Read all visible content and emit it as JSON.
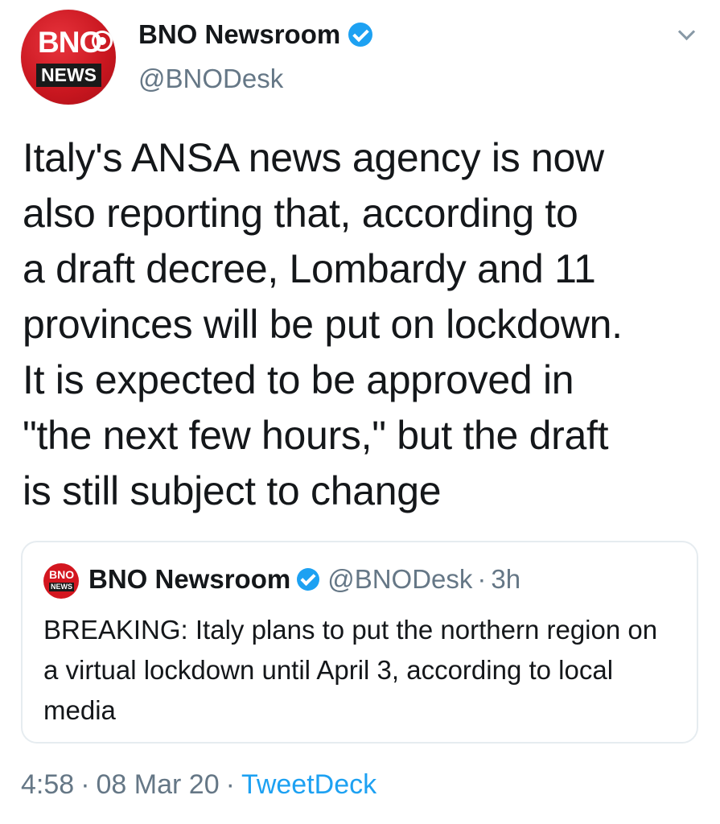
{
  "author": {
    "avatar_text_top": "BNO",
    "avatar_text_bottom": "NEWS",
    "name": "BNO Newsroom",
    "handle": "@BNODesk",
    "verified": true
  },
  "menu": {
    "icon": "chevron-down-icon"
  },
  "tweet": {
    "text": "Italy's ANSA news agency is now\nalso reporting that, according to\na draft decree, Lombardy and 11\nprovinces will be put on lockdown.\nIt is expected to be approved in\n\"the next few hours,\" but the draft\nis still subject to change"
  },
  "quoted_tweet": {
    "avatar_text_top": "BNO",
    "avatar_text_bottom": "NEWS",
    "name": "BNO Newsroom",
    "handle": "@BNODesk",
    "separator": "·",
    "time": "3h",
    "text": "BREAKING: Italy plans to put the northern region on a virtual lockdown until April 3, according to local media"
  },
  "footer": {
    "time": "4:58",
    "separator": "·",
    "date": "08 Mar 20",
    "source": "TweetDeck"
  },
  "colors": {
    "accent": "#1da1f2",
    "avatar_red": "#d3161f",
    "secondary_text": "#657786",
    "border": "#e6ecf0"
  }
}
